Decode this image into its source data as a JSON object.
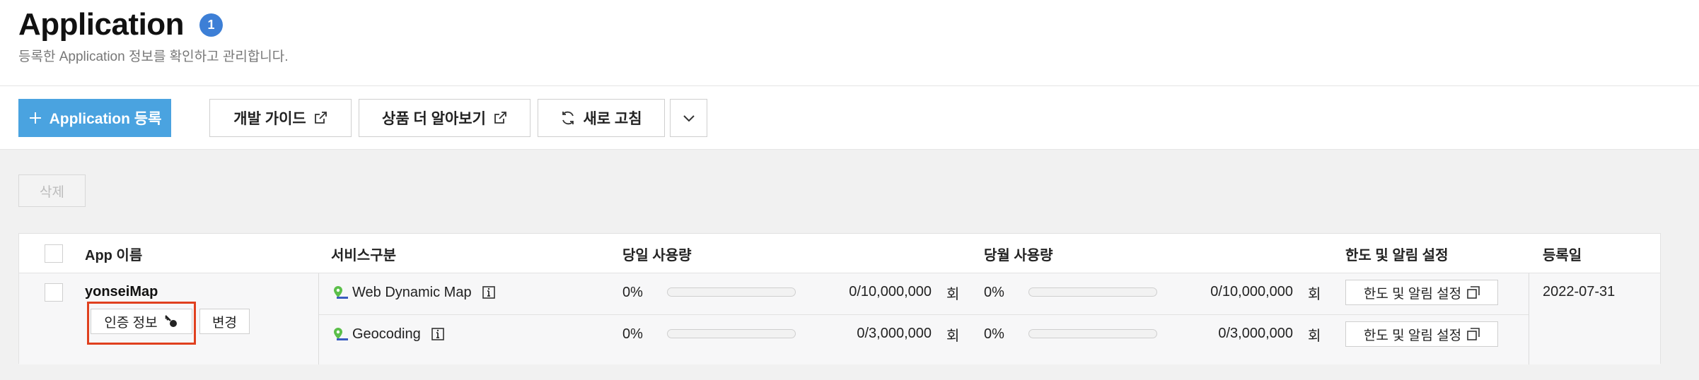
{
  "header": {
    "title": "Application",
    "count": "1",
    "subtitle": "등록한 Application 정보를 확인하고 관리합니다."
  },
  "toolbar": {
    "register_label": "Application 등록",
    "guide_label": "개발 가이드",
    "product_label": "상품 더 알아보기",
    "refresh_label": "새로 고침"
  },
  "actions": {
    "delete_label": "삭제"
  },
  "table": {
    "columns": {
      "app_name": "App 이름",
      "service": "서비스구분",
      "daily_usage": "당일 사용량",
      "monthly_usage": "당월 사용량",
      "limit": "한도 및 알림 설정",
      "registered": "등록일"
    },
    "rows": [
      {
        "app_name": "yonseiMap",
        "auth_label": "인증 정보",
        "change_label": "변경",
        "registered": "2022-07-31",
        "services": [
          {
            "name": "Web Dynamic Map",
            "daily_percent": "0%",
            "daily_progress": 0,
            "daily_count": "0/10,000,000",
            "daily_unit": "회",
            "monthly_percent": "0%",
            "monthly_progress": 0,
            "monthly_count": "0/10,000,000",
            "monthly_unit": "회",
            "limit_label": "한도 및 알림 설정"
          },
          {
            "name": "Geocoding",
            "daily_percent": "0%",
            "daily_progress": 0,
            "daily_count": "0/3,000,000",
            "daily_unit": "회",
            "monthly_percent": "0%",
            "monthly_progress": 0,
            "monthly_count": "0/3,000,000",
            "monthly_unit": "회",
            "limit_label": "한도 및 알림 설정"
          }
        ]
      }
    ]
  },
  "colors": {
    "primary": "#4aa3e0",
    "badge": "#3d7fd6",
    "highlight": "#e0401f"
  }
}
